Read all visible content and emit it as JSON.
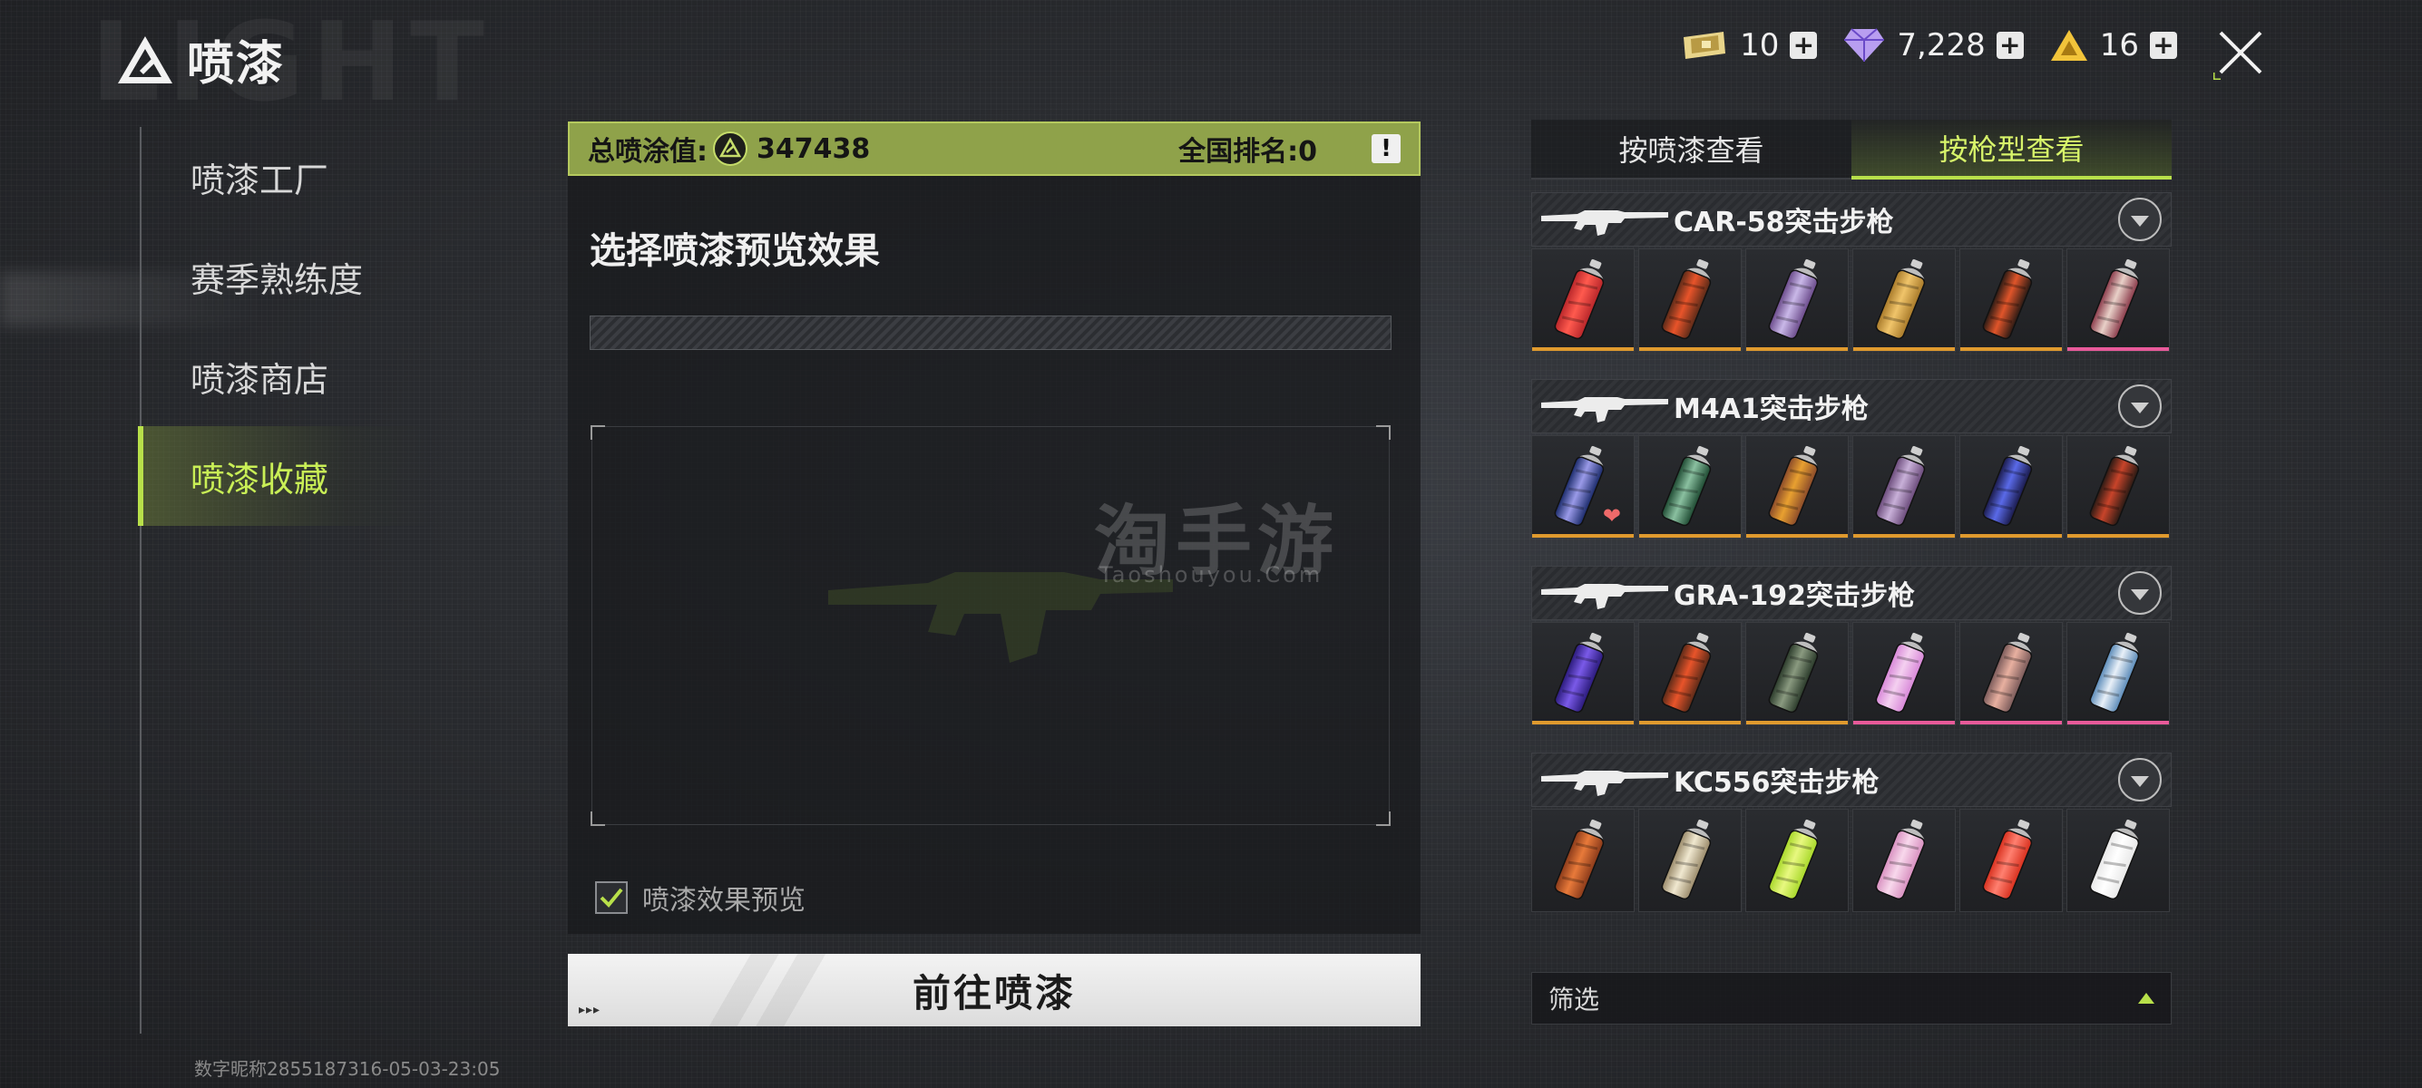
{
  "header": {
    "title": "喷漆",
    "watermark": "LIGHT",
    "currencies": [
      {
        "icon": "ticket-icon",
        "value": "10"
      },
      {
        "icon": "diamond-icon",
        "value": "7,228"
      },
      {
        "icon": "gold-triangle-icon",
        "value": "16"
      }
    ]
  },
  "nav": {
    "items": [
      {
        "label": "喷漆工厂",
        "active": false
      },
      {
        "label": "赛季熟练度",
        "active": false
      },
      {
        "label": "喷漆商店",
        "active": false
      },
      {
        "label": "喷漆收藏",
        "active": true
      }
    ],
    "footer_id": "数字昵称2855187316-05-03-23:05"
  },
  "center": {
    "score_label": "总喷涂值:",
    "score_value": "347438",
    "rank_label": "全国排名:0",
    "info_label": "!",
    "preview_title": "选择喷漆预览效果",
    "checkbox_label": "喷漆效果预览",
    "checkbox_checked": true,
    "go_button": "前往喷漆",
    "go_button_arrows": "▸▸▸"
  },
  "watermark": {
    "text": "淘手游",
    "sub": "Taoshouyou.Com"
  },
  "right": {
    "tabs": [
      {
        "label": "按喷漆查看",
        "active": false
      },
      {
        "label": "按枪型查看",
        "active": true
      }
    ],
    "weapons": [
      {
        "name": "CAR-58突击步枪",
        "cans": [
          {
            "color": "#b8262a",
            "accent": "#ff5a4e",
            "rarity": "#e09a2e"
          },
          {
            "color": "#5a2a18",
            "accent": "#e8542a",
            "rarity": "#e09a2e"
          },
          {
            "color": "#6a4a8a",
            "accent": "#c9b8e8",
            "rarity": "#e09a2e"
          },
          {
            "color": "#a87a2a",
            "accent": "#f0c46a",
            "rarity": "#e09a2e"
          },
          {
            "color": "#2a1a14",
            "accent": "#e0552a",
            "rarity": "#e09a2e"
          },
          {
            "color": "#8a3a4a",
            "accent": "#e8d0c8",
            "rarity": "#e85a9a"
          }
        ]
      },
      {
        "name": "M4A1突击步枪",
        "cans": [
          {
            "color": "#1a2a6a",
            "accent": "#9a9ae8",
            "rarity": "#e09a2e",
            "favorite": true
          },
          {
            "color": "#1e4a32",
            "accent": "#8ac0a0",
            "rarity": "#e09a2e"
          },
          {
            "color": "#8a4a2a",
            "accent": "#e8a030",
            "rarity": "#e09a2e"
          },
          {
            "color": "#6a4a7a",
            "accent": "#c8b0d8",
            "rarity": "#e09a2e"
          },
          {
            "color": "#1a1a4a",
            "accent": "#5a6ae8",
            "rarity": "#e09a2e"
          },
          {
            "color": "#2a1a14",
            "accent": "#c8442a",
            "rarity": "#e09a2e"
          }
        ]
      },
      {
        "name": "GRA-192突击步枪",
        "cans": [
          {
            "color": "#2a1a7a",
            "accent": "#7a5ae8",
            "rarity": "#e09a2e"
          },
          {
            "color": "#5a2a18",
            "accent": "#e8542a",
            "rarity": "#e09a2e"
          },
          {
            "color": "#2a3a2a",
            "accent": "#8a9a80",
            "rarity": "#e09a2e"
          },
          {
            "color": "#d888d8",
            "accent": "#f4d0f0",
            "rarity": "#e85a9a"
          },
          {
            "color": "#7a5a5a",
            "accent": "#e8b0a0",
            "rarity": "#e85a9a"
          },
          {
            "color": "#5a8ab8",
            "accent": "#e8f0f8",
            "rarity": "#e85a9a"
          }
        ]
      },
      {
        "name": "KC556突击步枪",
        "cans": [
          {
            "color": "#8a3a1a",
            "accent": "#e87a3a",
            "rarity": "none"
          },
          {
            "color": "#9a8a6a",
            "accent": "#f0e8d0",
            "rarity": "none"
          },
          {
            "color": "#a8d82a",
            "accent": "#e8f880",
            "rarity": "none"
          },
          {
            "color": "#d890c0",
            "accent": "#f8d8ec",
            "rarity": "none"
          },
          {
            "color": "#d8301e",
            "accent": "#ff8070",
            "rarity": "none"
          },
          {
            "color": "#e8e8e8",
            "accent": "#ffffff",
            "rarity": "none"
          }
        ]
      }
    ],
    "filter_label": "筛选"
  }
}
